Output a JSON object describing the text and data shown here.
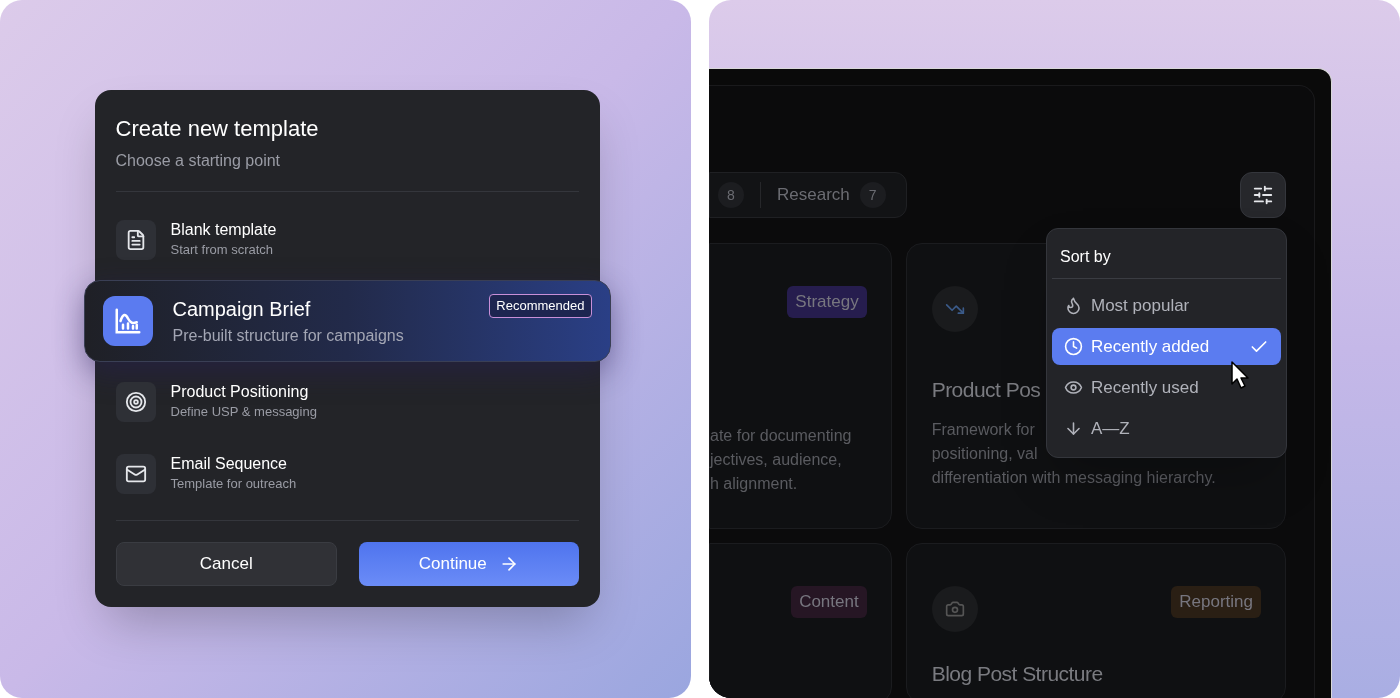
{
  "dialog": {
    "title": "Create new template",
    "subtitle": "Choose a starting point",
    "options": [
      {
        "title": "Blank template",
        "description": "Start from scratch",
        "selected": false
      },
      {
        "title": "Campaign Brief",
        "description": "Pre-built structure for campaigns",
        "selected": true,
        "badge": "Recommended"
      },
      {
        "title": "Product Positioning",
        "description": "Define USP & messaging",
        "selected": false
      },
      {
        "title": "Email Sequence",
        "description": "Template for outreach",
        "selected": false
      }
    ],
    "buttons": [
      {
        "label": "Cancel",
        "kind": "secondary"
      },
      {
        "label": "Continue",
        "kind": "primary"
      }
    ]
  },
  "screen": {
    "tabs": [
      {
        "count": "8"
      },
      {
        "label": "Research",
        "count": "7"
      }
    ],
    "cards": [
      {
        "tag": "Strategy",
        "color": "#261d4e",
        "lines": [
          "ate for documenting",
          "jectives, audience,",
          "h alignment."
        ]
      },
      {
        "title": "Product Pos",
        "lines": [
          "Framework for",
          "positioning, val",
          "differentiation with messaging hierarchy."
        ]
      },
      {
        "tag": "Content",
        "color": "#261624"
      },
      {
        "tag": "Reporting",
        "color": "#2a1f14",
        "title": "Blog Post Structure"
      }
    ],
    "sort_menu": {
      "title": "Sort by",
      "options": [
        {
          "label": "Most popular",
          "selected": false
        },
        {
          "label": "Recently added",
          "selected": true
        },
        {
          "label": "Recently used",
          "selected": false
        },
        {
          "label": "A—Z",
          "selected": false
        }
      ]
    }
  }
}
